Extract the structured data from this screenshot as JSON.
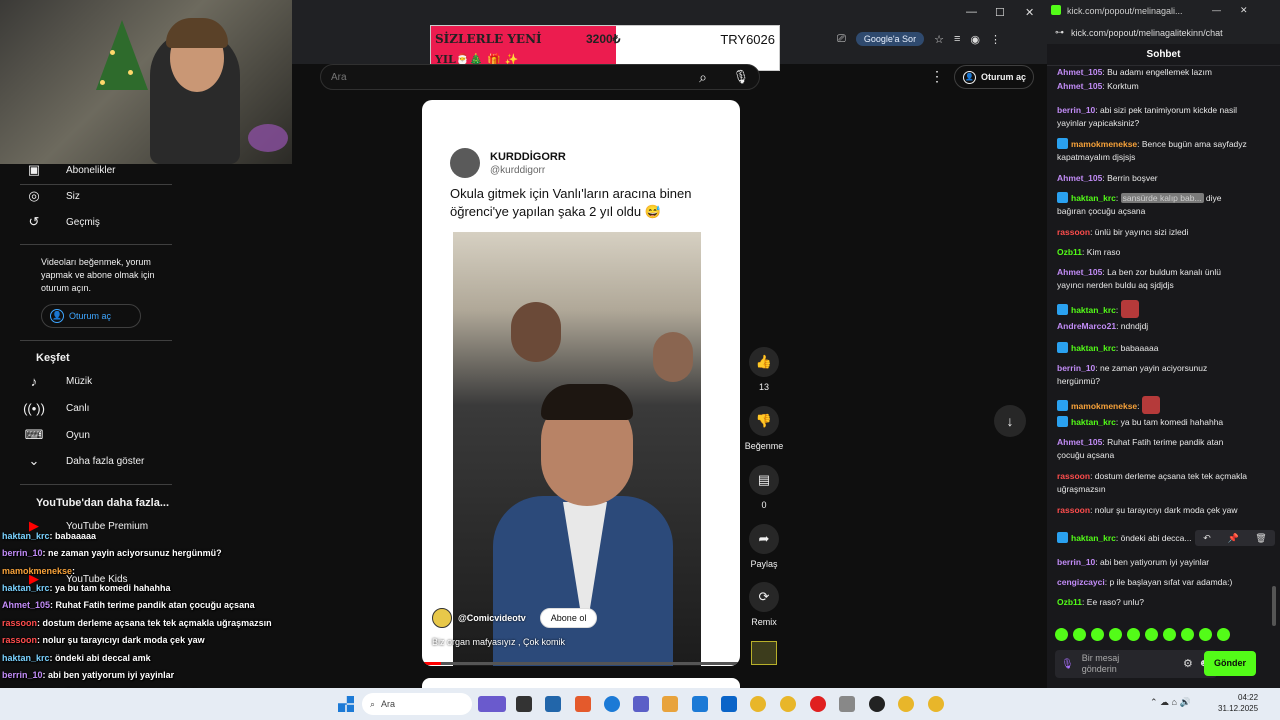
{
  "webcam": {
    "label": ""
  },
  "banner": {
    "title": "SİZLERLE YENİ",
    "line2": "YIL🎅🎄 🎁 ✨",
    "amount": "3200₺",
    "code": "TRY6026"
  },
  "browser": {
    "google_btn": "Google'a Sor"
  },
  "yt": {
    "search_placeholder": "Ara",
    "signin": "Oturum aç",
    "sidebar": {
      "abonelikler": "Abonelikler",
      "siz": "Siz",
      "gecmis": "Geçmiş",
      "signin_msg": "Videoları beğenmek, yorum yapmak ve abone olmak için oturum açın.",
      "signin_btn": "Oturum aç",
      "kesfet": "Keşfet",
      "muzik": "Müzik",
      "canli": "Canlı",
      "oyun": "Oyun",
      "daha_fazla": "Daha fazla göster",
      "more_from": "YouTube'dan daha fazla...",
      "premium": "YouTube Premium",
      "kids": "YouTube Kids"
    }
  },
  "short": {
    "tweet_name": "KURDDİGORR",
    "tweet_handle": "@kurddigorr",
    "tweet_text": "Okula gitmek için  Vanlı'ların aracına binen öğrenci'ye yapılan  şaka 2 yıl oldu 😅",
    "channel": "@Comicvideotv",
    "subscribe": "Abone ol",
    "caption": "Biz organ mafyasıyız , Çok komik",
    "progress": 0.06
  },
  "actions": {
    "likes": "13",
    "dislike": "Beğenme",
    "comments": "0",
    "share": "Paylaş",
    "remix": "Remix"
  },
  "overlay_chat": [
    {
      "u": "haktan_krc",
      "t": ": babaaaaa"
    },
    {
      "u": "berrin_10",
      "t": ": ne zaman yayin aciyorsunuz hergünmü?"
    },
    {
      "u": "mamokmenekse",
      "t": ": "
    },
    {
      "u": "haktan_krc",
      "t": ": ya bu tam komedi hahahha"
    },
    {
      "u": "Ahmet_105",
      "t": ": Ruhat Fatih terime pandik atan çocuğu açsana"
    },
    {
      "u": "rassoon",
      "t": ": dostum derleme açsana tek tek açmakla uğraşmazsın"
    },
    {
      "u": "rassoon",
      "t": ": nolur şu tarayıcıyı dark moda çek yaw"
    },
    {
      "u": "haktan_krc",
      "t": ": öndeki abi deccal amk"
    },
    {
      "u": "berrin_10",
      "t": ": abi ben yatiyorum iyi yayinlar"
    },
    {
      "u": "cengizcayci",
      "t": ": p ile başlayan sıfat var adamda:)"
    },
    {
      "u": "Ozb11",
      "t": ": Ee raso? unlu?"
    }
  ],
  "chat": {
    "title_url": "kick.com/popout/melinagali...",
    "url": "kick.com/popout/melinagalitekinn/chat",
    "header": "Sohbet",
    "messages": [
      {
        "u": "Ahmet_105",
        "c": "#c28cf7",
        "t": ": Bu adamı engellemek lazım",
        "badge": false
      },
      {
        "u": "Ahmet_105",
        "c": "#c28cf7",
        "t": ": Korktum",
        "badge": false
      },
      {
        "u": "berrin_10",
        "c": "#c28cf7",
        "t": ": abi sizi pek tanimiyorum kickde nasil yayinlar yapicaksiniz?",
        "badge": false
      },
      {
        "u": "mamokmenekse",
        "c": "#f7a23a",
        "t": ": Bence bugün ama sayfadyz kapatmayalım djsjsjs",
        "badge": true
      },
      {
        "u": "Ahmet_105",
        "c": "#c28cf7",
        "t": ": Berrin boşver",
        "badge": false
      },
      {
        "u": "haktan_krc",
        "c": "#53fc18",
        "t": ": ",
        "redact": "sansürde kalıp bab...",
        "after": " diye bağıran çocuğu açsana",
        "badge": true
      },
      {
        "u": "rassoon",
        "c": "#ff4d4d",
        "t": ": ünlü bir yayıncı sizi izledi",
        "badge": false
      },
      {
        "u": "Ozb11",
        "c": "#53fc18",
        "t": ": Kim raso",
        "badge": false
      },
      {
        "u": "Ahmet_105",
        "c": "#c28cf7",
        "t": ": La ben zor buldum kanalı ünlü yayıncı nerden buldu aq sjdjdjs",
        "badge": false
      },
      {
        "u": "haktan_krc",
        "c": "#53fc18",
        "t": ": ",
        "emote": true,
        "badge": true
      },
      {
        "u": "AndreMarco21",
        "c": "#c28cf7",
        "t": ": ndndjdj",
        "badge": false
      },
      {
        "u": "haktan_krc",
        "c": "#53fc18",
        "t": ": babaaaaa",
        "badge": true
      },
      {
        "u": "berrin_10",
        "c": "#c28cf7",
        "t": ": ne zaman yayin aciyorsunuz hergünmü?",
        "badge": false
      },
      {
        "u": "mamokmenekse",
        "c": "#f7a23a",
        "t": ": ",
        "emote": true,
        "badge": true
      },
      {
        "u": "haktan_krc",
        "c": "#53fc18",
        "t": ": ya bu tam komedi hahahha",
        "badge": true
      },
      {
        "u": "Ahmet_105",
        "c": "#c28cf7",
        "t": ": Ruhat Fatih terime pandik atan çocuğu açsana",
        "badge": false
      },
      {
        "u": "rassoon",
        "c": "#ff4d4d",
        "t": ": dostum derleme açsana tek tek açmakla uğraşmazsın",
        "badge": false
      },
      {
        "u": "rassoon",
        "c": "#ff4d4d",
        "t": ": nolur şu tarayıcıyı dark moda çek yaw",
        "badge": false
      },
      {
        "u": "haktan_krc",
        "c": "#53fc18",
        "t": ": öndeki abi decca...",
        "badge": true
      },
      {
        "u": "berrin_10",
        "c": "#c28cf7",
        "t": ": abi ben yatiyorum iyi yayinlar",
        "badge": false
      },
      {
        "u": "cengizcayci",
        "c": "#c28cf7",
        "t": ": p ile başlayan sıfat var adamda:)",
        "badge": false
      },
      {
        "u": "Ozb11",
        "c": "#53fc18",
        "t": ": Ee raso? unlu?",
        "badge": false
      }
    ],
    "input_placeholder": "Bir mesaj gönderin",
    "send": "Gönder"
  },
  "taskbar": {
    "search": "Ara",
    "time": "04:22",
    "date": "31.12.2025"
  }
}
